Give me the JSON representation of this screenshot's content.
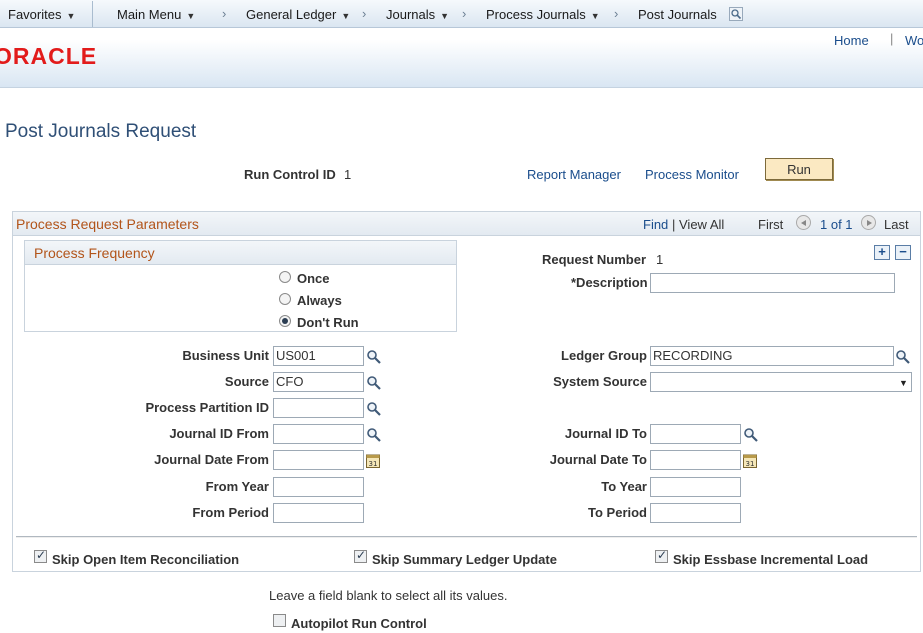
{
  "nav": {
    "favorites": "Favorites",
    "main_menu": "Main Menu",
    "general_ledger": "General Ledger",
    "journals": "Journals",
    "process_journals": "Process Journals",
    "post_journals": "Post Journals",
    "chevron": "›",
    "dropdown": "▼"
  },
  "header": {
    "logo": "ORACLE",
    "home": "Home",
    "worklist_partial": "Wo",
    "sep": "|"
  },
  "page": {
    "title": "Post Journals Request"
  },
  "run_control": {
    "label": "Run Control ID",
    "value": "1",
    "report_manager": "Report Manager",
    "process_monitor": "Process Monitor",
    "run_button": "Run"
  },
  "group": {
    "title": "Process Request Parameters",
    "find": "Find",
    "view_all": "View All",
    "sep": "|",
    "first": "First",
    "position": "1 of 1",
    "last": "Last",
    "add": "+",
    "remove": "−"
  },
  "frequency": {
    "title": "Process Frequency",
    "options": [
      {
        "label": "Once",
        "selected": false
      },
      {
        "label": "Always",
        "selected": false
      },
      {
        "label": "Don't Run",
        "selected": true
      }
    ]
  },
  "request": {
    "number_label": "Request Number",
    "number_value": "1",
    "description_label": "*Description",
    "description_value": ""
  },
  "fields": {
    "business_unit": {
      "label": "Business Unit",
      "value": "US001"
    },
    "source": {
      "label": "Source",
      "value": "CFO"
    },
    "process_partition_id": {
      "label": "Process Partition ID",
      "value": ""
    },
    "journal_id_from": {
      "label": "Journal ID From",
      "value": ""
    },
    "journal_date_from": {
      "label": "Journal Date From",
      "value": ""
    },
    "from_year": {
      "label": "From Year",
      "value": ""
    },
    "from_period": {
      "label": "From Period",
      "value": ""
    },
    "ledger_group": {
      "label": "Ledger Group",
      "value": "RECORDING"
    },
    "system_source": {
      "label": "System Source",
      "value": ""
    },
    "journal_id_to": {
      "label": "Journal ID To",
      "value": ""
    },
    "journal_date_to": {
      "label": "Journal Date To",
      "value": ""
    },
    "to_year": {
      "label": "To Year",
      "value": ""
    },
    "to_period": {
      "label": "To Period",
      "value": ""
    }
  },
  "options": {
    "skip_open_item": {
      "label": "Skip Open Item Reconciliation",
      "checked": true
    },
    "skip_summary_ledger": {
      "label": "Skip Summary Ledger Update",
      "checked": true
    },
    "skip_essbase": {
      "label": "Skip Essbase Incremental Load",
      "checked": true
    }
  },
  "footer": {
    "hint": "Leave a field blank to select all its values.",
    "autopilot": {
      "label": "Autopilot Run Control",
      "checked": false
    }
  },
  "colors": {
    "link": "#1a4d8c",
    "section_title": "#b2541a",
    "oracle_red": "#e21b1b",
    "run_button": "#fbe9c2"
  }
}
